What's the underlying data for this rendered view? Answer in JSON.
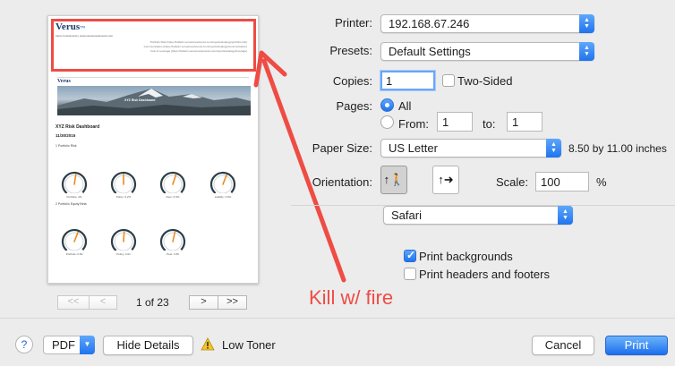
{
  "preview": {
    "logo": "Verus",
    "logo_tagline": "Verus Investments | www.verusinvestments.com",
    "header_lines": [
      "Portfolio Risk (https://bulletin.verusinvestments.com/reports/analogy/portfolio risk)",
      "Communication (https://bulletin.verusinvestments.com/reports/analogy/communication)",
      "Cost & Leverage (https://bulletin.verusinvestments.com/reports/analogy/leverage)"
    ],
    "banner_logo": "Verus",
    "banner_caption": "XYZ Risk Dashboard",
    "title": "XYZ Risk Dashboard",
    "date": "11/30/2015",
    "section1": "1 Portfolio Risk",
    "section2": "2 Portfolio Equity Beta",
    "gauges_row1": [
      {
        "label": "Portfolio: 4%",
        "level": 0.55
      },
      {
        "label": "Policy: 6.2%",
        "level": 0.5
      },
      {
        "label": "Peer: 6.3%",
        "level": 0.6
      },
      {
        "label": "Liability: 4.9%",
        "level": 0.62
      }
    ],
    "gauges_row2": [
      {
        "label": "Portfolio: 0.83",
        "level": 0.62
      },
      {
        "label": "Policy: 0.61",
        "level": 0.52
      },
      {
        "label": "Peer: 0.66",
        "level": 0.57
      }
    ]
  },
  "pager": {
    "first": "<<",
    "prev": "<",
    "page_info": "1 of 23",
    "next": ">",
    "last": ">>"
  },
  "form": {
    "printer_label": "Printer:",
    "printer_value": "192.168.67.246",
    "presets_label": "Presets:",
    "presets_value": "Default Settings",
    "copies_label": "Copies:",
    "copies_value": "1",
    "two_sided_label": "Two-Sided",
    "pages_label": "Pages:",
    "pages_all_label": "All",
    "pages_from_label": "From:",
    "pages_from_value": "1",
    "pages_to_label": "to:",
    "pages_to_value": "1",
    "paper_size_label": "Paper Size:",
    "paper_size_value": "US Letter",
    "paper_dims": "8.50 by 11.00 inches",
    "orientation_label": "Orientation:",
    "scale_label": "Scale:",
    "scale_value": "100",
    "scale_unit": "%",
    "app_section_value": "Safari",
    "print_backgrounds_label": "Print backgrounds",
    "print_headers_label": "Print headers and footers"
  },
  "bottom": {
    "help": "?",
    "pdf_label": "PDF",
    "hide_details_label": "Hide Details",
    "low_toner_label": "Low Toner",
    "cancel_label": "Cancel",
    "print_label": "Print"
  },
  "annotation": {
    "text": "Kill w/ fire",
    "color": "#ee4c44"
  },
  "colors": {
    "accent": "#1f73ee",
    "annotation_red": "#ee4c44"
  }
}
